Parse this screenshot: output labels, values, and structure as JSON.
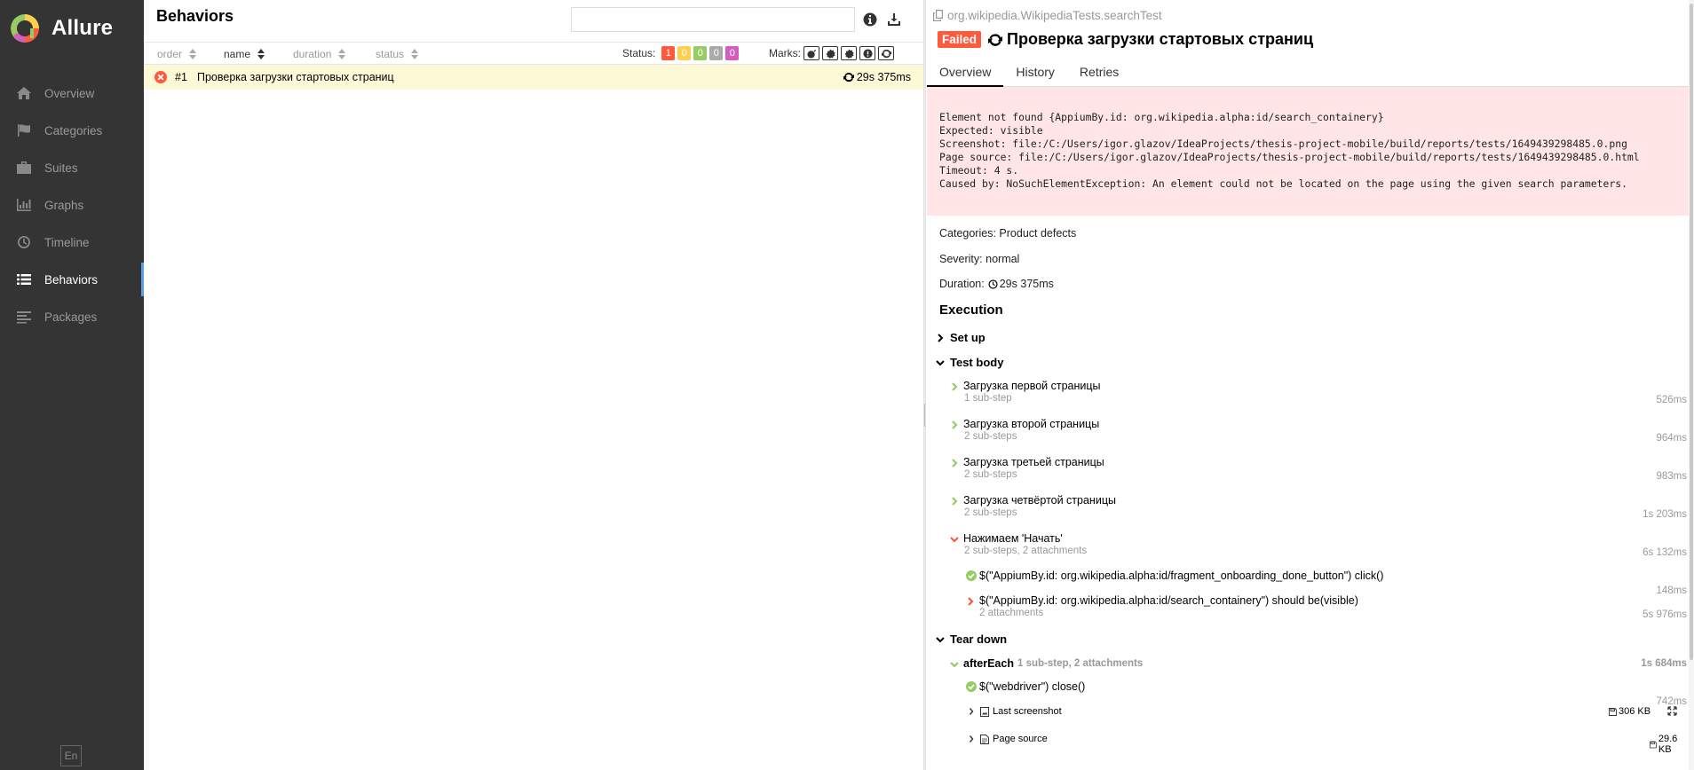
{
  "sidebar": {
    "brand": "Allure",
    "items": [
      {
        "label": "Overview",
        "icon": "home-icon"
      },
      {
        "label": "Categories",
        "icon": "flag-icon"
      },
      {
        "label": "Suites",
        "icon": "briefcase-icon"
      },
      {
        "label": "Graphs",
        "icon": "bar-chart-icon"
      },
      {
        "label": "Timeline",
        "icon": "clock-icon"
      },
      {
        "label": "Behaviors",
        "icon": "list-icon",
        "active": true
      },
      {
        "label": "Packages",
        "icon": "align-left-icon"
      }
    ],
    "language": "En"
  },
  "behaviors": {
    "title": "Behaviors",
    "search": {
      "value": "",
      "placeholder": ""
    },
    "sort": {
      "order": "order",
      "name": "name",
      "duration": "duration",
      "status": "status"
    },
    "status_label": "Status:",
    "status_counts": [
      {
        "value": "1",
        "color": "#fd5a3e"
      },
      {
        "value": "0",
        "color": "#ffd050"
      },
      {
        "value": "0",
        "color": "#97cc64"
      },
      {
        "value": "0",
        "color": "#aaaaaa"
      },
      {
        "value": "0",
        "color": "#d35ebe"
      }
    ],
    "marks_label": "Marks:",
    "rows": [
      {
        "number": "#1",
        "name": "Проверка загрузки стартовых страниц",
        "duration": "29s 375ms",
        "status": "failed"
      }
    ]
  },
  "test": {
    "path": "org.wikipedia.WikipediaTests.searchTest",
    "status": "Failed",
    "title": "Проверка загрузки стартовых страниц",
    "tabs": [
      "Overview",
      "History",
      "Retries"
    ],
    "error": "Element not found {AppiumBy.id: org.wikipedia.alpha:id/search_containery}\nExpected: visible\nScreenshot: file:/C:/Users/igor.glazov/IdeaProjects/thesis-project-mobile/build/reports/tests/1649439298485.0.png\nPage source: file:/C:/Users/igor.glazov/IdeaProjects/thesis-project-mobile/build/reports/tests/1649439298485.0.html\nTimeout: 4 s.\nCaused by: NoSuchElementException: An element could not be located on the page using the given search parameters.",
    "categories_label": "Categories:",
    "categories_value": "Product defects",
    "severity_label": "Severity:",
    "severity_value": "normal",
    "duration_label": "Duration:",
    "duration_value": "29s 375ms",
    "execution_title": "Execution",
    "setup_label": "Set up",
    "body_label": "Test body",
    "steps": [
      {
        "name": "Загрузка первой страницы",
        "sub": "1 sub-step",
        "duration": "526ms",
        "status": "passed"
      },
      {
        "name": "Загрузка второй страницы",
        "sub": "2 sub-steps",
        "duration": "964ms",
        "status": "passed"
      },
      {
        "name": "Загрузка третьей страницы",
        "sub": "2 sub-steps",
        "duration": "983ms",
        "status": "passed"
      },
      {
        "name": "Загрузка четвёртой страницы",
        "sub": "2 sub-steps",
        "duration": "1s 203ms",
        "status": "passed"
      },
      {
        "name": "Нажимаем 'Начать'",
        "sub": "2 sub-steps, 2 attachments",
        "duration": "6s 132ms",
        "status": "failed"
      }
    ],
    "substeps": [
      {
        "name": "$(\"AppiumBy.id: org.wikipedia.alpha:id/fragment_onboarding_done_button\") click()",
        "duration": "148ms",
        "status": "passed"
      },
      {
        "name": "$(\"AppiumBy.id: org.wikipedia.alpha:id/search_containery\") should be(visible)",
        "sub": "2 attachments",
        "duration": "5s 976ms",
        "status": "failed"
      }
    ],
    "teardown_label": "Tear down",
    "after_each": {
      "name": "afterEach",
      "sub": "1 sub-step, 2 attachments",
      "duration": "1s 684ms"
    },
    "webdriver": {
      "name": "$(\"webdriver\") close()",
      "duration": "742ms"
    },
    "attachments": [
      {
        "name": "Last screenshot",
        "size": "306 KB"
      },
      {
        "name": "Page source",
        "size": "29.6 KB"
      }
    ]
  }
}
